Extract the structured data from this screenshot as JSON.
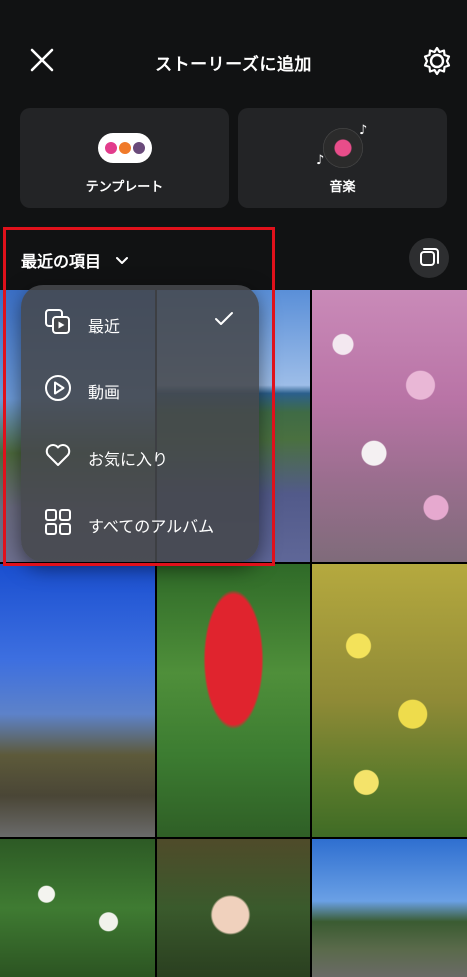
{
  "header": {
    "title": "ストーリーズに追加",
    "close_icon": "close-icon",
    "settings_icon": "gear-icon"
  },
  "cards": [
    {
      "label": "テンプレート",
      "icon": "template-icon"
    },
    {
      "label": "音楽",
      "icon": "music-disc-icon"
    }
  ],
  "album": {
    "current": "最近の項目",
    "chevron_icon": "chevron-down-icon",
    "multi_select_icon": "multi-select-icon"
  },
  "menu": {
    "items": [
      {
        "label": "最近",
        "icon": "recent-media-icon",
        "selected": true
      },
      {
        "label": "動画",
        "icon": "play-circle-icon",
        "selected": false
      },
      {
        "label": "お気に入り",
        "icon": "heart-icon",
        "selected": false
      },
      {
        "label": "すべてのアルバム",
        "icon": "grid-icon",
        "selected": false
      }
    ]
  },
  "colors": {
    "background": "#000000",
    "panel": "#111213",
    "card": "#232426",
    "highlight": "#e0111b"
  }
}
